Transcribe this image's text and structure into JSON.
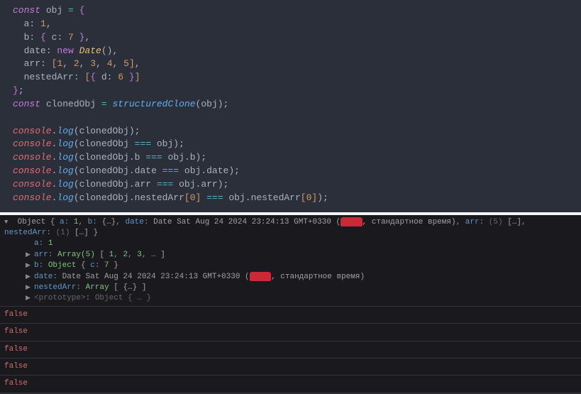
{
  "code": {
    "l1": {
      "kw": "const",
      "var": " obj ",
      "op": "=",
      "brace": " {"
    },
    "l2": {
      "prop": "  a",
      "colon": ": ",
      "num": "1",
      "comma": ","
    },
    "l3": {
      "prop": "  b",
      "colon": ": ",
      "brace1": "{ ",
      "prop2": "c",
      "colon2": ": ",
      "num": "7",
      "brace2": " }",
      "comma": ","
    },
    "l4": {
      "prop": "  date",
      "colon": ": ",
      "kw": "new",
      "sp": " ",
      "class": "Date",
      "paren": "()",
      "comma": ","
    },
    "l5": {
      "prop": "  arr",
      "colon": ": ",
      "b1": "[",
      "n1": "1",
      "c1": ", ",
      "n2": "2",
      "c2": ", ",
      "n3": "3",
      "c3": ", ",
      "n4": "4",
      "c4": ", ",
      "n5": "5",
      "b2": "]",
      "comma": ","
    },
    "l6": {
      "prop": "  nestedArr",
      "colon": ": ",
      "b1": "[",
      "brace1": "{ ",
      "prop2": "d",
      "colon2": ": ",
      "num": "6",
      "brace2": " }",
      "b2": "]"
    },
    "l7": {
      "brace": "}",
      "semi": ";"
    },
    "l8": {
      "kw": "const",
      "var": " clonedObj ",
      "op": "=",
      "sp": " ",
      "fn": "structuredClone",
      "p1": "(",
      "arg": "obj",
      "p2": ")",
      "semi": ";"
    },
    "l10": {
      "obj": "console",
      "dot": ".",
      "fn": "log",
      "p1": "(",
      "arg": "clonedObj",
      "p2": ")",
      "semi": ";"
    },
    "l11": {
      "obj": "console",
      "dot": ".",
      "fn": "log",
      "p1": "(",
      "a1": "clonedObj ",
      "op": "===",
      "a2": " obj",
      "p2": ")",
      "semi": ";"
    },
    "l12": {
      "obj": "console",
      "dot": ".",
      "fn": "log",
      "p1": "(",
      "a1": "clonedObj",
      "d1": ".",
      "pr1": "b ",
      "op": "===",
      "a2": " obj",
      "d2": ".",
      "pr2": "b",
      "p2": ")",
      "semi": ";"
    },
    "l13": {
      "obj": "console",
      "dot": ".",
      "fn": "log",
      "p1": "(",
      "a1": "clonedObj",
      "d1": ".",
      "pr1": "date ",
      "op": "===",
      "a2": " obj",
      "d2": ".",
      "pr2": "date",
      "p2": ")",
      "semi": ";"
    },
    "l14": {
      "obj": "console",
      "dot": ".",
      "fn": "log",
      "p1": "(",
      "a1": "clonedObj",
      "d1": ".",
      "pr1": "arr ",
      "op": "===",
      "a2": " obj",
      "d2": ".",
      "pr2": "arr",
      "p2": ")",
      "semi": ";"
    },
    "l15": {
      "obj": "console",
      "dot": ".",
      "fn": "log",
      "p1": "(",
      "a1": "clonedObj",
      "d1": ".",
      "pr1": "nestedArr",
      "b1": "[",
      "n1": "0",
      "b2": "] ",
      "op": "===",
      "a2": " obj",
      "d2": ".",
      "pr2": "nestedArr",
      "b3": "[",
      "n2": "0",
      "b4": "]",
      "p2": ")",
      "semi": ";"
    }
  },
  "console": {
    "obj_header": {
      "prefix": "Object { ",
      "a_key": "a",
      "a_val": "1",
      "b_key": "b",
      "b_val": "{…}",
      "date_key": "date",
      "date_val_pre": "Date Sat Aug 24 2024 23:24:13 GMT+0330 (",
      "redact": "████",
      "date_val_post": ", стандартное время)",
      "arr_key": "arr",
      "arr_len": "(5)",
      "arr_val": "[…]",
      "na_key": "nestedArr",
      "na_len": "(1)",
      "na_val": "[…]",
      "suffix": " }"
    },
    "exp": {
      "a": {
        "key": "a",
        "val": "1"
      },
      "arr": {
        "key": "arr",
        "pre": "Array(5) ",
        "b1": "[ ",
        "v1": "1",
        "c1": ", ",
        "v2": "2",
        "c2": ", ",
        "v3": "3",
        "c3": ", … ",
        "b2": "]"
      },
      "b": {
        "key": "b",
        "pre": "Object ",
        "b1": "{ ",
        "ck": "c",
        "cv": "7",
        "b2": " }"
      },
      "date": {
        "key": "date",
        "pre": "Date Sat Aug 24 2024 23:24:13 GMT+0330 (",
        "redact": "████",
        "post": ", стандартное время)"
      },
      "na": {
        "key": "nestedArr",
        "pre": "Array ",
        "b1": "[ ",
        "v": "{…}",
        "b2": " ]"
      },
      "proto": {
        "key": "<prototype>",
        "val": "Object { … }"
      }
    },
    "falses": [
      "false",
      "false",
      "false",
      "false",
      "false"
    ]
  }
}
